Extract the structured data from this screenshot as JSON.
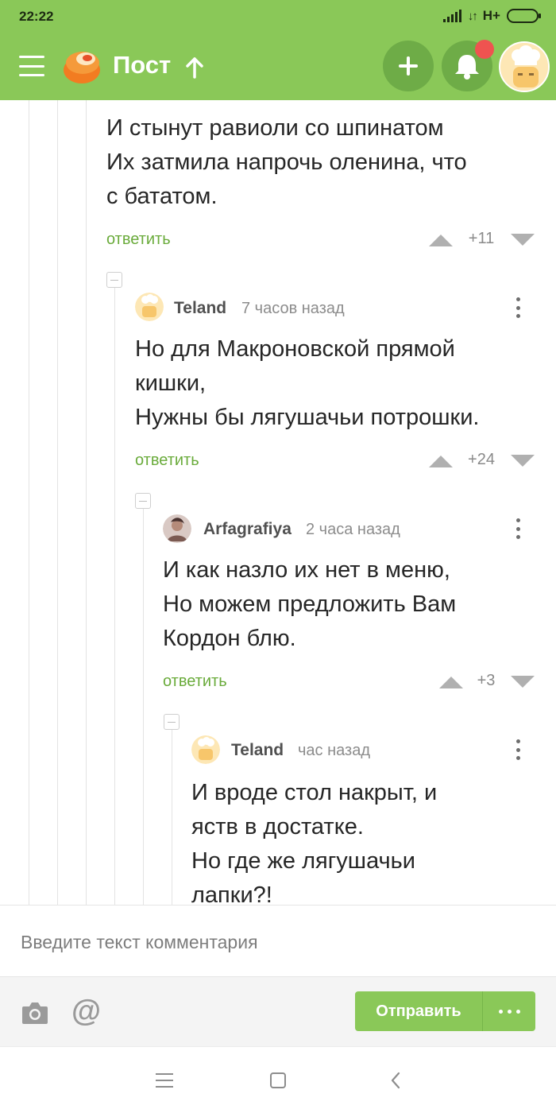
{
  "status_bar": {
    "time": "22:22",
    "network_type": "H+",
    "icons": [
      "signal-icon",
      "data-arrows-icon",
      "battery-icon"
    ]
  },
  "app_bar": {
    "title": "Пост",
    "icons": [
      "menu-icon",
      "pikabu-logo-icon",
      "arrow-up-icon",
      "plus-icon",
      "bell-icon",
      "user-avatar"
    ],
    "notification_dot_color": "#ef5350",
    "brand_color": "#8ac858"
  },
  "comments": [
    {
      "text": "И стынут равиоли со шпинатом\nИх затмила напрочь оленина, что\nс бататом.",
      "reply_label": "ответить",
      "score": "+11"
    },
    {
      "author": "Teland",
      "time": "7 часов назад",
      "text": "Но для Макроновской прямой\nкишки,\nНужны бы лягушачьи потрошки.",
      "reply_label": "ответить",
      "score": "+24"
    },
    {
      "author": "Arfagrafiya",
      "time": "2 часа назад",
      "text": "И как назло их нет в меню,\nНо можем предложить Вам\nКордон блю.",
      "reply_label": "ответить",
      "score": "+3"
    },
    {
      "author": "Teland",
      "time": "час назад",
      "text": "И вроде стол накрыт, и\nяств в достатке.\nНо где же лягушачьи\nлапки?!"
    }
  ],
  "composer": {
    "placeholder": "Введите текст комментария",
    "send_label": "Отправить",
    "icons": [
      "camera-icon",
      "mention-icon",
      "more-dots-icon"
    ]
  },
  "nav_bar": {
    "icons": [
      "recents-icon",
      "home-icon",
      "back-icon"
    ]
  }
}
